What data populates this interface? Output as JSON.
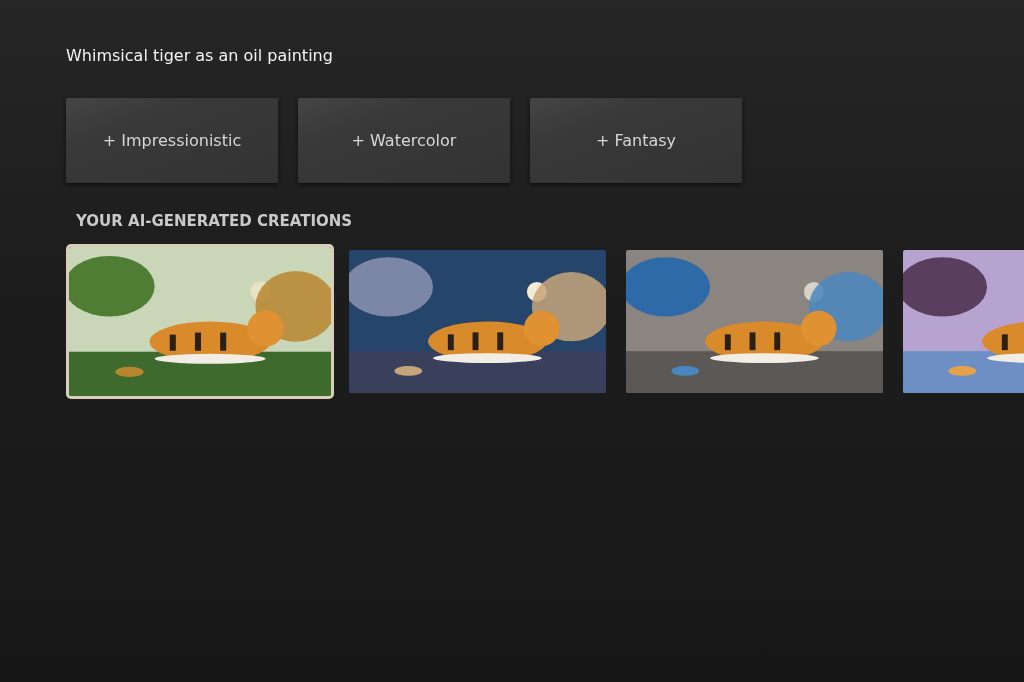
{
  "prompt": "Whimsical tiger as an oil painting",
  "style_buttons": [
    {
      "label": "+ Impressionistic"
    },
    {
      "label": "+ Watercolor"
    },
    {
      "label": "+ Fantasy"
    }
  ],
  "creations_heading": "YOUR AI-GENERATED CREATIONS",
  "creations": [
    {
      "kind": "picture",
      "selected": true
    },
    {
      "kind": "picture",
      "selected": false
    },
    {
      "kind": "picture",
      "selected": false
    },
    {
      "kind": "picture",
      "selected": false
    }
  ]
}
